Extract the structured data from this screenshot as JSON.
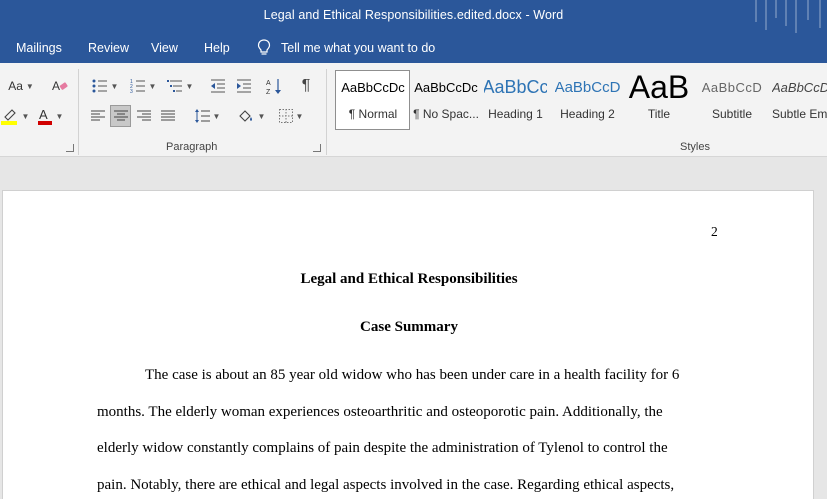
{
  "window": {
    "title": "Legal and Ethical Responsibilities.edited.docx  -  Word"
  },
  "menu": {
    "items": [
      "Mailings",
      "Review",
      "View",
      "Help"
    ],
    "tell_me": "Tell me what you want to do"
  },
  "ribbon": {
    "font_case_label": "Aa",
    "paragraph_group_label": "Paragraph",
    "styles_group_label": "Styles",
    "pilcrow": "¶",
    "styles": [
      {
        "sample": "AaBbCcDc",
        "name": "¶ Normal"
      },
      {
        "sample": "AaBbCcDc",
        "name": "¶ No Spac..."
      },
      {
        "sample": "AaBbCc",
        "name": "Heading 1"
      },
      {
        "sample": "AaBbCcD",
        "name": "Heading 2"
      },
      {
        "sample": "AaB",
        "name": "Title"
      },
      {
        "sample": "AaBbCcD",
        "name": "Subtitle"
      },
      {
        "sample": "AaBbCcDc",
        "name": "Subtle Em..."
      }
    ],
    "colors": {
      "highlight": "#ffff00",
      "font_color": "#d00000",
      "heading_blue": "#2e74b5"
    }
  },
  "document": {
    "page_number": "2",
    "title": "Legal and Ethical Responsibilities",
    "subtitle": "Case Summary",
    "lines": [
      "The case is about an 85 year old widow who has been under care in a health facility for 6",
      "months. The elderly woman experiences osteoarthritic and osteoporotic pain. Additionally, the",
      "elderly widow constantly complains of pain despite the administration of Tylenol to control the",
      "pain. Notably, there are ethical and legal aspects involved in the case. Regarding ethical aspects,"
    ]
  }
}
